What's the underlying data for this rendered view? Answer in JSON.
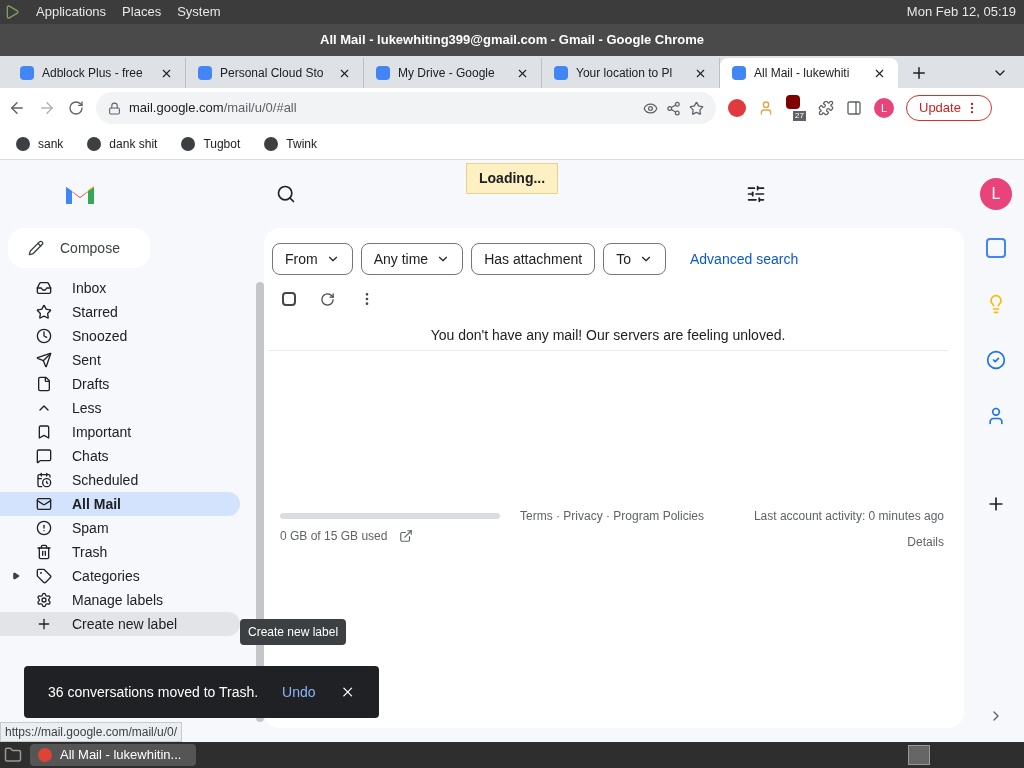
{
  "desktop_bar": {
    "menus": [
      "Applications",
      "Places",
      "System"
    ],
    "clock": "Mon Feb 12, 05:19"
  },
  "window": {
    "title": "All Mail - lukewhiting399@gmail.com - Gmail - Google Chrome"
  },
  "tabs": [
    {
      "label": "Adblock Plus - free",
      "selected": false
    },
    {
      "label": "Personal Cloud Sto",
      "selected": false
    },
    {
      "label": "My Drive - Google",
      "selected": false
    },
    {
      "label": "Your location to Pl",
      "selected": false
    },
    {
      "label": "All Mail - lukewhiti",
      "selected": true
    }
  ],
  "address_bar": {
    "host": "mail.google.com",
    "path": "/mail/u/0/#all"
  },
  "toolbar": {
    "extension_badge": "27",
    "profile_initial": "L",
    "update_button": "Update"
  },
  "bookmarks": [
    "sank",
    "dank shit",
    "Tugbot",
    "Twink"
  ],
  "gmail": {
    "loading": "Loading...",
    "avatar": "L",
    "compose": "Compose",
    "nav": [
      {
        "label": "Inbox",
        "selected": false,
        "hovered": false,
        "kind": "link"
      },
      {
        "label": "Starred",
        "selected": false,
        "hovered": false,
        "kind": "link"
      },
      {
        "label": "Snoozed",
        "selected": false,
        "hovered": false,
        "kind": "link"
      },
      {
        "label": "Sent",
        "selected": false,
        "hovered": false,
        "kind": "link"
      },
      {
        "label": "Drafts",
        "selected": false,
        "hovered": false,
        "kind": "link"
      },
      {
        "label": "Less",
        "selected": false,
        "hovered": false,
        "kind": "link"
      },
      {
        "label": "Important",
        "selected": false,
        "hovered": false,
        "kind": "link"
      },
      {
        "label": "Chats",
        "selected": false,
        "hovered": false,
        "kind": "link"
      },
      {
        "label": "Scheduled",
        "selected": false,
        "hovered": false,
        "kind": "link"
      },
      {
        "label": "All Mail",
        "selected": true,
        "hovered": false,
        "kind": "link"
      },
      {
        "label": "Spam",
        "selected": false,
        "hovered": false,
        "kind": "link"
      },
      {
        "label": "Trash",
        "selected": false,
        "hovered": false,
        "kind": "link"
      },
      {
        "label": "Categories",
        "selected": false,
        "hovered": false,
        "kind": "folder"
      },
      {
        "label": "Manage labels",
        "selected": false,
        "hovered": false,
        "kind": "link"
      },
      {
        "label": "Create new label",
        "selected": false,
        "hovered": true,
        "kind": "link"
      }
    ],
    "filters": [
      "From",
      "Any time",
      "Has attachment",
      "To"
    ],
    "select_all": {
      "checked": false
    },
    "advanced_search": "Advanced search",
    "empty_message": "You don't have any mail! Our servers are feeling unloved.",
    "storage": {
      "text": "0 GB of 15 GB used",
      "level": 0
    },
    "footer_links": "Terms · Privacy · Program Policies",
    "last_activity": "Last account activity: 0 minutes ago",
    "details": "Details",
    "tooltip": "Create new label",
    "toast": {
      "message": "36 conversations moved to Trash.",
      "action": "Undo"
    }
  },
  "status_url": "https://mail.google.com/mail/u/0/",
  "taskbar": {
    "window": "All Mail - lukewhitin..."
  }
}
